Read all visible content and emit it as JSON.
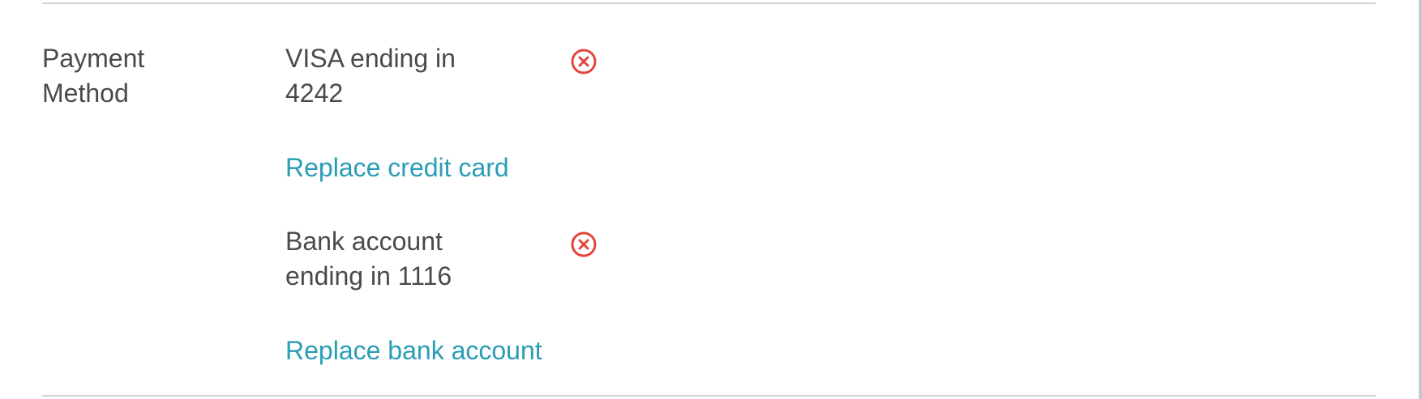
{
  "section": {
    "label": "Payment\nMethod"
  },
  "payment_methods": [
    {
      "description": "VISA ending in 4242",
      "replace_label": "Replace credit card",
      "remove_icon": "remove-circle-x-icon"
    },
    {
      "description": "Bank account ending in 1116",
      "replace_label": "Replace bank account",
      "remove_icon": "remove-circle-x-icon"
    }
  ],
  "colors": {
    "text": "#4a4a4a",
    "link": "#2a9db4",
    "remove": "#e2463f",
    "divider": "#d2d2d2"
  }
}
